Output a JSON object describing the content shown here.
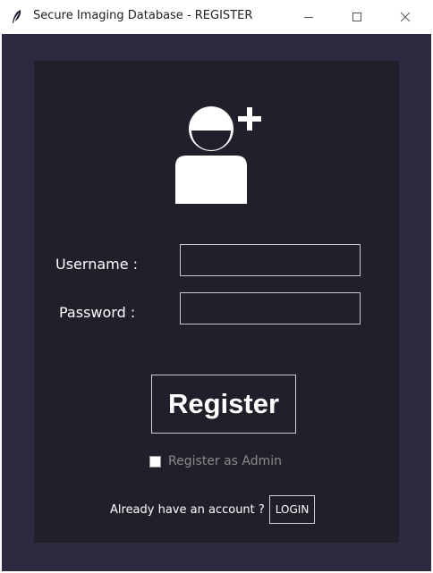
{
  "window": {
    "title": "Secure Imaging Database - REGISTER",
    "icon": "feather-icon",
    "controls": [
      "minimize-icon",
      "maximize-icon",
      "close-icon"
    ]
  },
  "form": {
    "icon": "user-add-icon",
    "username_label": "Username :",
    "username_value": "",
    "password_label": "Password :",
    "password_value": "",
    "register_label": "Register",
    "admin_checkbox_label": "Register as Admin",
    "admin_checked": false,
    "login_prompt": "Already have an account ?",
    "login_label": "LOGIN"
  },
  "colors": {
    "client_background": "#2b2a40",
    "panel_background": "#1f2029",
    "text": "#ffffff",
    "muted_text": "#8a8a8a"
  }
}
